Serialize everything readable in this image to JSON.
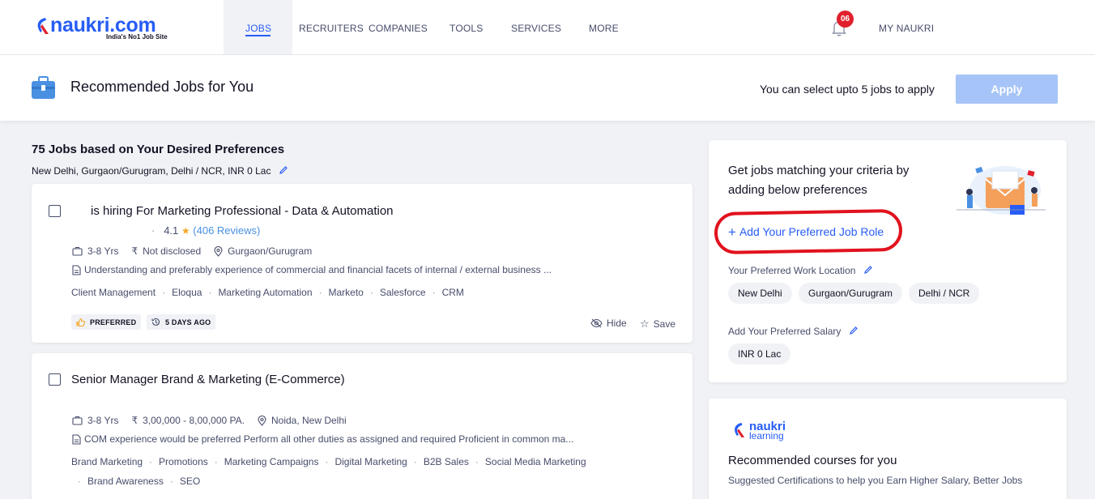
{
  "header": {
    "logo_word": "naukri.com",
    "logo_tagline": "India's No1 Job Site",
    "nav": [
      "JOBS",
      "RECRUITERS",
      "COMPANIES",
      "TOOLS",
      "SERVICES",
      "MORE"
    ],
    "notification_count": "06",
    "my_naukri": "MY NAUKRI"
  },
  "recommend_bar": {
    "title": "Recommended Jobs for You",
    "note": "You can select upto 5 jobs to apply",
    "apply_label": "Apply"
  },
  "results": {
    "title": "75 Jobs based on Your Desired Preferences",
    "subtitle": "New Delhi, Gurgaon/Gurugram, Delhi / NCR, INR 0 Lac"
  },
  "jobs": [
    {
      "title": "is hiring For Marketing Professional - Data & Automation",
      "rating": "4.1",
      "reviews": "(406 Reviews)",
      "experience": "3-8 Yrs",
      "salary": "Not disclosed",
      "location": "Gurgaon/Gurugram",
      "description": "Understanding and preferably experience of commercial and financial facets of internal / external business ...",
      "tags": [
        "Client Management",
        "Eloqua",
        "Marketing Automation",
        "Marketo",
        "Salesforce",
        "CRM"
      ],
      "badge_preferred": "PREFERRED",
      "posted": "5 DAYS AGO",
      "hide_label": "Hide",
      "save_label": "Save"
    },
    {
      "title": "Senior Manager Brand & Marketing (E-Commerce)",
      "experience": "3-8 Yrs",
      "salary": "3,00,000 - 8,00,000 PA.",
      "location": "Noida, New Delhi",
      "description": "COM experience would be preferred Perform all other duties as assigned and required Proficient in common ma...",
      "tags": [
        "Brand Marketing",
        "Promotions",
        "Marketing Campaigns",
        "Digital Marketing",
        "B2B Sales",
        "Social Media Marketing"
      ],
      "tags_line2": [
        "Brand Awareness",
        "SEO"
      ]
    }
  ],
  "preferences": {
    "heading": "Get jobs matching your criteria by adding below preferences",
    "add_role": "Add Your Preferred Job Role",
    "location_label": "Your Preferred Work Location",
    "locations": [
      "New Delhi",
      "Gurgaon/Gurugram",
      "Delhi / NCR"
    ],
    "salary_label": "Add Your Preferred Salary",
    "salary_value": "INR 0 Lac"
  },
  "learning": {
    "logo_word1": "naukri",
    "logo_word2": "learning",
    "title": "Recommended courses for you",
    "subtitle": "Suggested Certifications to help you Earn Higher Salary, Better Jobs"
  },
  "colors": {
    "brand_blue": "#275df5",
    "annotation_red": "#e1121e",
    "badge_red": "#e1202e",
    "apply_disabled": "#a6c4f7"
  }
}
